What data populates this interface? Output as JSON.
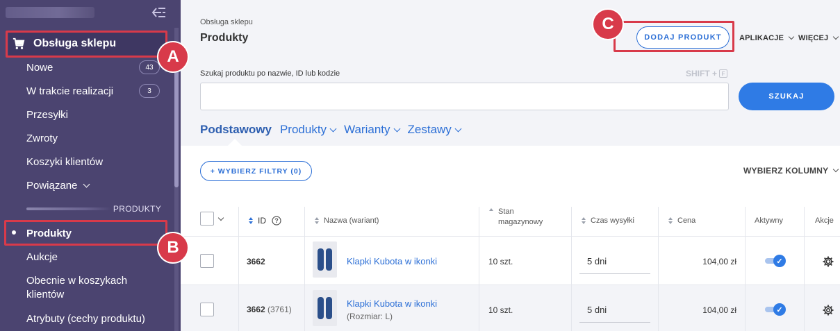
{
  "sidebar": {
    "section_label": "Obsługa sklepu",
    "items": [
      {
        "label": "Nowe",
        "badge": "43"
      },
      {
        "label": "W trakcie realizacji",
        "badge": "3"
      },
      {
        "label": "Przesyłki"
      },
      {
        "label": "Zwroty"
      },
      {
        "label": "Koszyki klientów"
      },
      {
        "label": "Powiązane"
      }
    ],
    "group_label": "PRODUKTY",
    "product_items": [
      {
        "label": "Produkty"
      },
      {
        "label": "Aukcje"
      },
      {
        "label": "Obecnie w koszykach klientów"
      },
      {
        "label": "Atrybuty (cechy produktu)"
      }
    ]
  },
  "markers": {
    "a": "A",
    "b": "B",
    "c": "C"
  },
  "header": {
    "breadcrumb": "Obsługa sklepu",
    "title": "Produkty",
    "add_button": "DODAJ PRODUKT",
    "apps_menu": "APLIKACJE",
    "more_menu": "WIĘCEJ"
  },
  "search": {
    "label": "Szukaj produktu po nazwie, ID lub kodzie",
    "shortcut": "SHIFT +",
    "shortcut_key": "F",
    "button": "SZUKAJ",
    "value": ""
  },
  "tabs": [
    "Podstawowy",
    "Produkty",
    "Warianty",
    "Zestawy"
  ],
  "toolbar": {
    "filter_button": "+ WYBIERZ FILTRY (0)",
    "columns_button": "WYBIERZ KOLUMNY"
  },
  "table": {
    "columns": {
      "id": "ID",
      "name": "Nazwa (wariant)",
      "stock": "Stan magazynowy",
      "shipping": "Czas wysyłki",
      "price": "Cena",
      "active": "Aktywny",
      "actions": "Akcje"
    },
    "rows": [
      {
        "id": "3662",
        "variant_id": "",
        "name": "Klapki Kubota w ikonki",
        "variant": "",
        "stock": "10 szt.",
        "shipping": "5 dni",
        "price": "104,00 zł",
        "active": true
      },
      {
        "id": "3662",
        "variant_id": "(3761)",
        "name": "Klapki Kubota w ikonki",
        "variant": "(Rozmiar: L)",
        "stock": "10 szt.",
        "shipping": "5 dni",
        "price": "104,00 zł",
        "active": true
      }
    ]
  },
  "colors": {
    "sidebar": "#4b4470",
    "accent": "#2c6fd6",
    "annotation": "#d83a4a"
  }
}
